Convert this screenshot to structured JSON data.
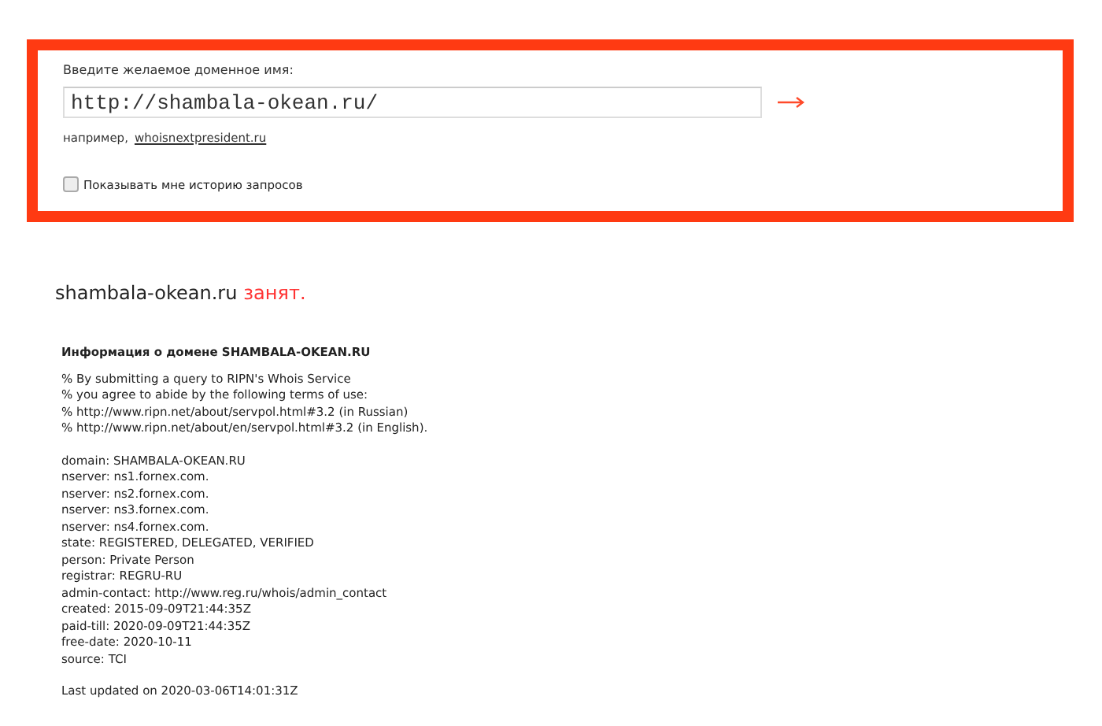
{
  "search": {
    "label": "Введите желаемое доменное имя:",
    "value": "http://shambala-okean.ru/",
    "example_prefix": "например,",
    "example_link": "whoisnextpresident.ru",
    "history_checkbox": {
      "label": "Показывать мне историю запросов",
      "checked": false
    }
  },
  "result": {
    "domain": "shambala-okean.ru",
    "status": "занят."
  },
  "info": {
    "heading": "Информация о домене SHAMBALA-OKEAN.RU",
    "notice": [
      "% By submitting a query to RIPN's Whois Service",
      "% you agree to abide by the following terms of use:",
      "% http://www.ripn.net/about/servpol.html#3.2 (in Russian)",
      "% http://www.ripn.net/about/en/servpol.html#3.2 (in English)."
    ],
    "record": [
      "domain: SHAMBALA-OKEAN.RU",
      "nserver: ns1.fornex.com.",
      "nserver: ns2.fornex.com.",
      "nserver: ns3.fornex.com.",
      "nserver: ns4.fornex.com.",
      "state: REGISTERED, DELEGATED, VERIFIED",
      "person: Private Person",
      "registrar: REGRU-RU",
      "admin-contact: http://www.reg.ru/whois/admin_contact",
      "created: 2015-09-09T21:44:35Z",
      "paid-till: 2020-09-09T21:44:35Z",
      "free-date: 2020-10-11",
      "source: TCI"
    ],
    "last_updated": "Last updated on 2020-03-06T14:01:31Z"
  }
}
